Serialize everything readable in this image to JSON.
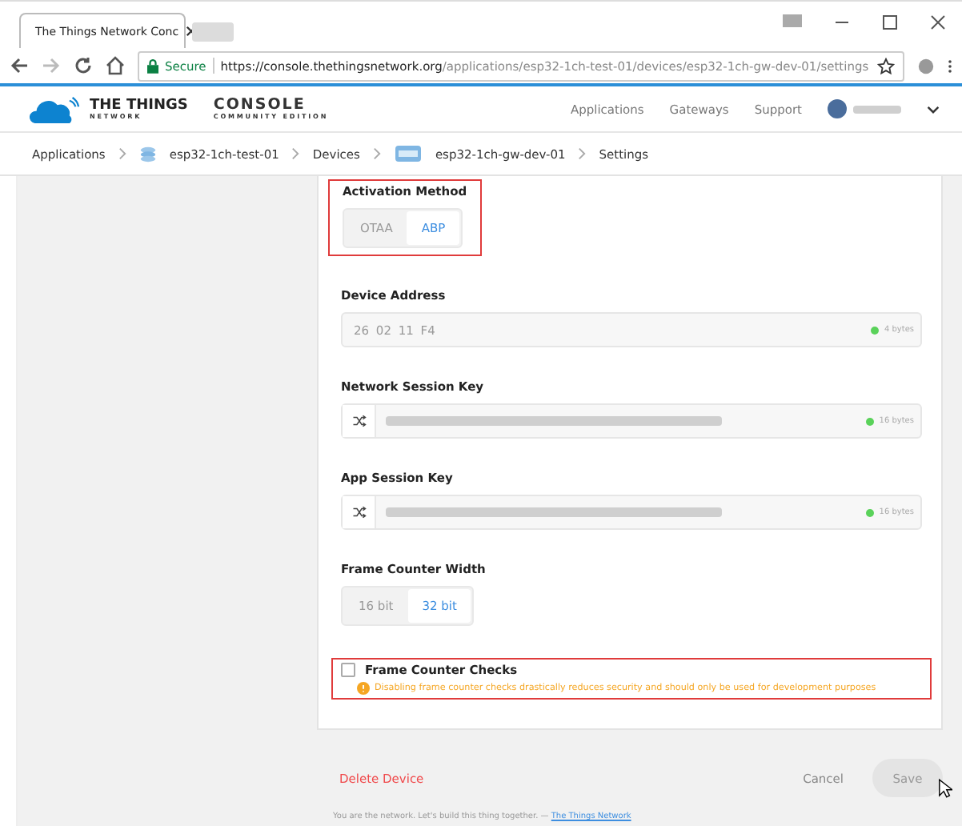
{
  "browser": {
    "tab_title": "The Things Network Conс",
    "url_secure_label": "Secure",
    "url_host": "https://console.thethingsnetwork.org",
    "url_path": "/applications/esp32-1ch-test-01/devices/esp32-1ch-gw-dev-01/settings"
  },
  "header": {
    "logo_title": "THE THINGS",
    "logo_sub": "NETWORK",
    "console": "CONSOLE",
    "edition": "COMMUNITY EDITION",
    "nav": [
      "Applications",
      "Gateways",
      "Support"
    ]
  },
  "breadcrumb": [
    {
      "label": "Applications",
      "kind": "text"
    },
    {
      "label": "esp32-1ch-test-01",
      "kind": "app"
    },
    {
      "label": "Devices",
      "kind": "text"
    },
    {
      "label": "esp32-1ch-gw-dev-01",
      "kind": "device"
    },
    {
      "label": "Settings",
      "kind": "text"
    }
  ],
  "sections": [
    {
      "kind": "toggle",
      "label": "Activation Method",
      "highlight": true,
      "options": [
        {
          "label": "OTAA",
          "selected": false
        },
        {
          "label": "ABP",
          "selected": true
        }
      ]
    },
    {
      "kind": "field",
      "label": "Device Address",
      "value": "26 02 11 F4",
      "shuffle": false,
      "size": "4 bytes"
    },
    {
      "kind": "field",
      "label": "Network Session Key",
      "redacted": true,
      "shuffle": true,
      "size": "16 bytes"
    },
    {
      "kind": "field",
      "label": "App Session Key",
      "redacted": true,
      "shuffle": true,
      "size": "16 bytes"
    },
    {
      "kind": "toggle",
      "label": "Frame Counter Width",
      "highlight": false,
      "options": [
        {
          "label": "16 bit",
          "selected": false
        },
        {
          "label": "32 bit",
          "selected": true
        }
      ]
    },
    {
      "kind": "checkbox",
      "label": "Frame Counter Checks",
      "checked": false,
      "highlight": true,
      "warning": "Disabling frame counter checks drastically reduces security and should only be used for development purposes"
    }
  ],
  "actions": {
    "delete": "Delete Device",
    "cancel": "Cancel",
    "save": "Save"
  },
  "footer": {
    "text": "You are the network. Let's build this thing together. —",
    "link": "The Things Network"
  }
}
